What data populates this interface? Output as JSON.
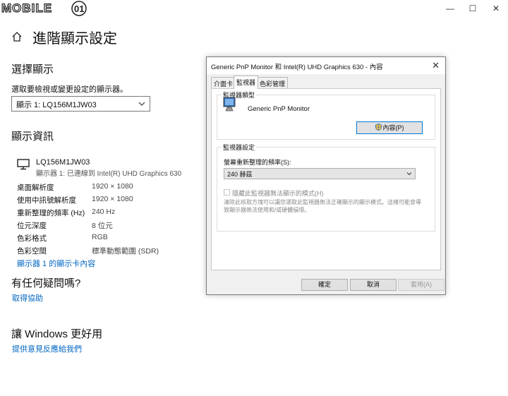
{
  "window": {
    "brand": "MOBILE01",
    "controls": {
      "minimize": "—",
      "maximize": "☐",
      "close": "✕"
    }
  },
  "page": {
    "title": "進階顯示設定",
    "select_section": {
      "heading": "選擇顯示",
      "subtitle": "選取要檢視或變更設定的顯示器。",
      "selected_display": "顯示 1: LQ156M1JW03"
    },
    "info_section": {
      "heading": "顯示資訊",
      "monitor_name": "LQ156M1JW03",
      "connection": "顯示器 1: 已連線到 Intel(R) UHD Graphics 630",
      "rows": [
        {
          "label": "桌面解析度",
          "value": "1920 × 1080"
        },
        {
          "label": "使用中訊號解析度",
          "value": "1920 × 1080"
        },
        {
          "label": "重新整理的頻率 (Hz)",
          "value": "240 Hz"
        },
        {
          "label": "位元深度",
          "value": "8 位元"
        },
        {
          "label": "色彩格式",
          "value": "RGB"
        },
        {
          "label": "色彩空間",
          "value": "標準動態範圍 (SDR)"
        }
      ],
      "adapter_link": "顯示器 1 的顯示卡內容"
    },
    "help_section": {
      "heading": "有任何疑問嗎?",
      "link": "取得協助"
    },
    "feedback_section": {
      "heading": "讓 Windows 更好用",
      "link": "提供意見反應給我們"
    }
  },
  "dialog": {
    "title": "Generic PnP Monitor 和 Intel(R) UHD Graphics 630 - 內容",
    "close": "✕",
    "tabs": [
      "介面卡",
      "監視器",
      "色彩管理"
    ],
    "active_tab": "監視器",
    "monitor_type": {
      "label": "監視器類型",
      "name": "Generic PnP Monitor",
      "properties_button": "內容(P)"
    },
    "monitor_settings": {
      "label": "監視器設定",
      "refresh_label": "螢幕重新整理的頻率(S):",
      "refresh_value": "240 赫茲",
      "hide_modes_label": "隱藏此監視器無法顯示的模式(H)",
      "hide_modes_checked": false,
      "hide_modes_desc": "清除此核取方塊可以讓您選取此監視器無法正確顯示的顯示模式。這樣可能會導致顯示器無法使用和/或硬體損壞。"
    },
    "buttons": {
      "ok": "確定",
      "cancel": "取消",
      "apply": "套用(A)"
    }
  },
  "colors": {
    "link": "#0067c0",
    "focus_border": "#0078d7",
    "dialog_bg": "#f0f0f0"
  }
}
